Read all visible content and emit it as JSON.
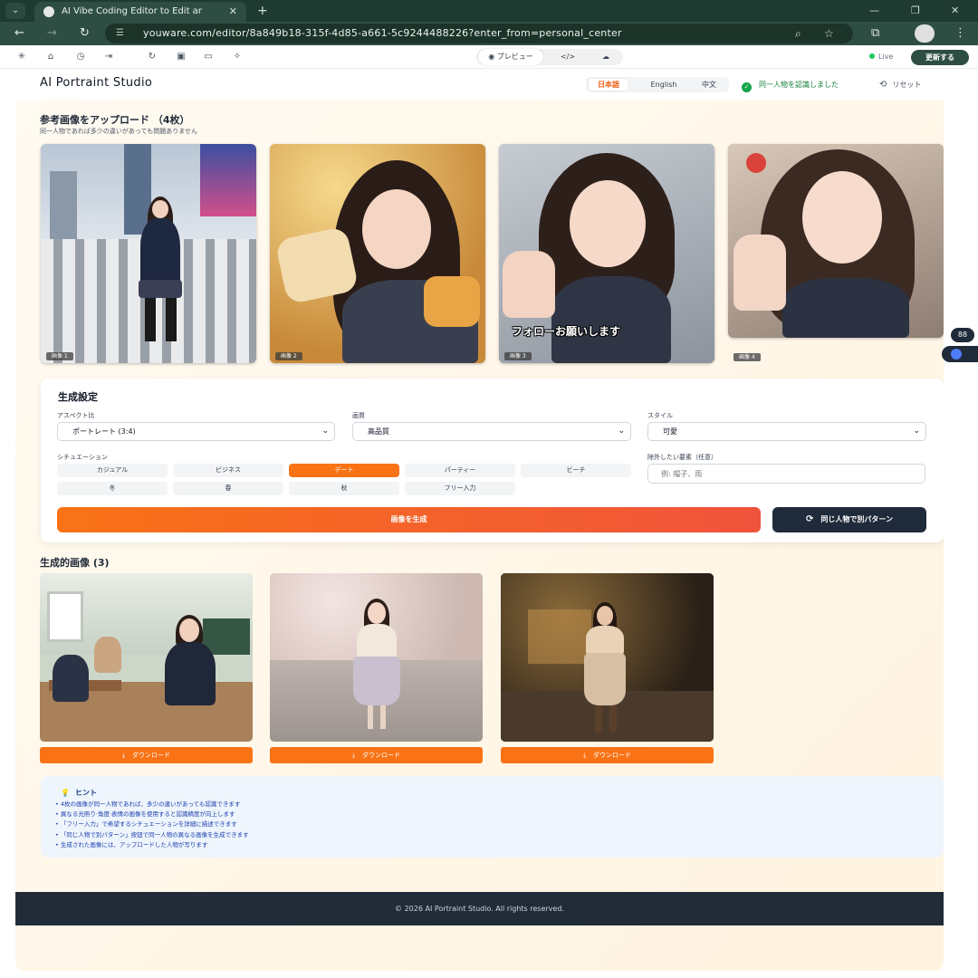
{
  "browser": {
    "tab_title": "AI Vibe Coding Editor to Edit ar",
    "url": "youware.com/editor/8a849b18-315f-4d85-a661-5c9244488226?enter_from=personal_center"
  },
  "editor": {
    "tabs": [
      "プレビュー",
      "</>",
      "☁"
    ],
    "live_label": "Live",
    "update_button": "更新する"
  },
  "header": {
    "title": "AI Portraint Studio",
    "languages": [
      "日本語",
      "English",
      "中文"
    ],
    "active_language": "日本語",
    "recognized_label": "同一人物を認識しました",
    "reset_label": "リセット"
  },
  "upload": {
    "title": "参考画像をアップロード （4枚）",
    "subtitle": "同一人物であれば多少の違いがあっても問題ありません",
    "images": [
      {
        "label": "画像 1"
      },
      {
        "label": "画像 2"
      },
      {
        "label": "画像 3",
        "caption": "フォローお願いします"
      },
      {
        "label": "画像 4"
      }
    ]
  },
  "settings": {
    "title": "生成設定",
    "aspect_label": "アスペクト比",
    "aspect_value": "ポートレート (3:4)",
    "quality_label": "画質",
    "quality_value": "高品質",
    "style_label": "スタイル",
    "style_value": "可愛",
    "situation_label": "シチュエーション",
    "situations": [
      "カジュアル",
      "ビジネス",
      "デート",
      "パーティー",
      "ビーチ",
      "冬",
      "春",
      "秋",
      "フリー入力"
    ],
    "active_situation": "デート",
    "exclude_label": "除外したい要素（任意）",
    "exclude_placeholder": "例: 帽子、雨",
    "generate_button": "画像を生成",
    "alt_button": "同じ人物で別パターン"
  },
  "generated": {
    "title": "生成的画像 (3)",
    "download_label": "ダウンロード",
    "count": 3
  },
  "tips": {
    "title": "ヒント",
    "items": [
      "• 4枚の画像が同一人物であれば、多少の違いがあっても認識できます",
      "• 異なる光照り·角度·表情の画像を使用すると認識精度が向上します",
      "• 「フリー入力」で希望するシチュエーションを詳細に描述できます",
      "• 「同じ人物で別パターン」按钮で同一人物の異なる画像を生成できます",
      "• 生成された画像には、アップロードした人物が写ります"
    ]
  },
  "footer": {
    "text": "© 2026 AI Portraint Studio. All rights reserved."
  },
  "colors": {
    "accent": "#f97316",
    "dark": "#1f2a3a",
    "success": "#16a34a"
  }
}
